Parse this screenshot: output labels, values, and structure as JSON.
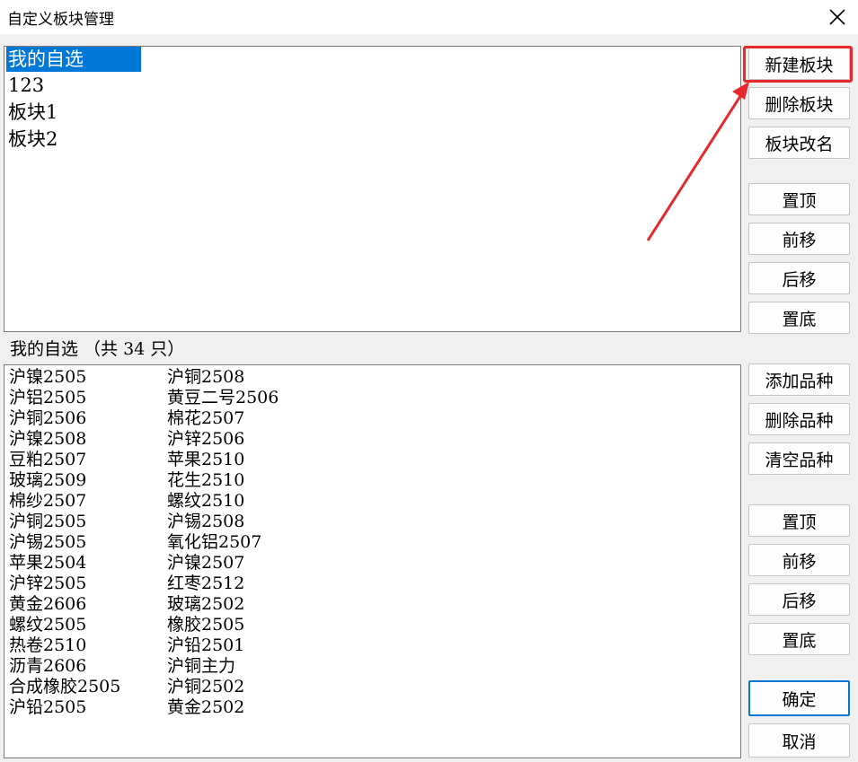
{
  "window": {
    "title": "自定义板块管理"
  },
  "boards": {
    "items": [
      "我的自选",
      "123",
      "板块1",
      "板块2"
    ],
    "selected_index": 0
  },
  "board_buttons": {
    "new": "新建板块",
    "delete": "删除板块",
    "rename": "板块改名",
    "top": "置顶",
    "up": "前移",
    "down": "后移",
    "bottom": "置底"
  },
  "items_header": "我的自选 （共 34 只）",
  "items": {
    "col1": [
      "沪镍2505",
      "沪铝2505",
      "沪铜2506",
      "沪镍2508",
      "豆粕2507",
      "玻璃2509",
      "棉纱2507",
      "沪铜2505",
      "沪锡2505",
      "苹果2504",
      "沪锌2505",
      "黄金2606",
      "螺纹2505",
      "热卷2510",
      "沥青2606",
      "合成橡胶2505",
      "沪铅2505"
    ],
    "col2": [
      "沪铜2508",
      "黄豆二号2506",
      "棉花2507",
      "沪锌2506",
      "苹果2510",
      "花生2510",
      "螺纹2510",
      "沪锡2508",
      "氧化铝2507",
      "沪镍2507",
      "红枣2512",
      "玻璃2502",
      "橡胶2505",
      "沪铅2501",
      "沪铜主力",
      "沪铜2502",
      "黄金2502"
    ]
  },
  "item_buttons": {
    "add": "添加品种",
    "delete": "删除品种",
    "clear": "清空品种",
    "top": "置顶",
    "up": "前移",
    "down": "后移",
    "bottom": "置底"
  },
  "dialog_buttons": {
    "ok": "确定",
    "cancel": "取消"
  },
  "colors": {
    "selection": "#0078d7",
    "annotation": "#e8282a"
  },
  "icons": {
    "close": "close-icon"
  }
}
